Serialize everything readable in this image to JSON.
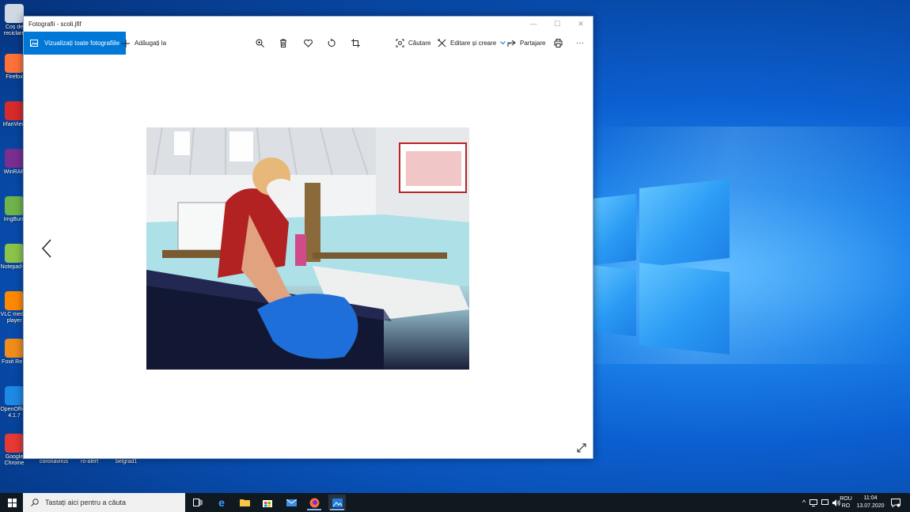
{
  "window": {
    "title": "Fotografii - scoli.jfif"
  },
  "toolbar": {
    "view_all_label": "Vizualizați toate fotografiile",
    "add_to_label": "Adăugați la",
    "search_label": "Căutare",
    "edit_create_label": "Editare și creare",
    "share_label": "Partajare",
    "more_label": "···"
  },
  "desktop": {
    "icons": [
      {
        "label": "Coș de\nreciclare",
        "icon": "recycle-bin-icon",
        "color": "#cfd8e3"
      },
      {
        "label": "Firefox",
        "icon": "firefox-icon",
        "color": "#ff7139"
      },
      {
        "label": "IrfanView",
        "icon": "irfanview-icon",
        "color": "#d62b2b"
      },
      {
        "label": "WinRAR",
        "icon": "winrar-icon",
        "color": "#7a2f8f"
      },
      {
        "label": "ImgBurn",
        "icon": "imgburn-icon",
        "color": "#6fb34a"
      },
      {
        "label": "Notepad++",
        "icon": "notepad-icon",
        "color": "#8bc34a"
      },
      {
        "label": "VLC media\nplayer",
        "icon": "vlc-icon",
        "color": "#ff8800"
      },
      {
        "label": "Foxit Re...",
        "icon": "foxit-icon",
        "color": "#f08c1b"
      },
      {
        "label": "OpenOffice\n4.1.7",
        "icon": "openoffice-icon",
        "color": "#1e88e5"
      },
      {
        "label": "Google\nChrome",
        "icon": "chrome-icon",
        "color": "#e53935"
      }
    ],
    "bottom_labels": [
      "coronavirus",
      "ro-alert",
      "belgrad1"
    ]
  },
  "taskbar": {
    "search_placeholder": "Tastați aici pentru a căuta",
    "lang_top": "ROU",
    "lang_bottom": "RO",
    "time": "11:04",
    "date": "13.07.2020"
  },
  "colors": {
    "accent": "#0078d7",
    "taskbar": "#101820"
  }
}
